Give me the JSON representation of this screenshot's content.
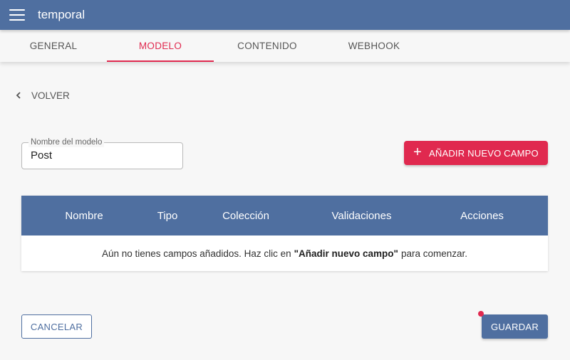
{
  "appbar": {
    "menu_icon": "hamburger-menu-icon",
    "title": "temporal"
  },
  "tabs": [
    {
      "label": "GENERAL",
      "active": false
    },
    {
      "label": "MODELO",
      "active": true
    },
    {
      "label": "CONTENIDO",
      "active": false
    },
    {
      "label": "WEBHOOK",
      "active": false
    }
  ],
  "back": {
    "icon": "chevron-left-icon",
    "label": "VOLVER"
  },
  "model_name": {
    "label": "Nombre del modelo",
    "value": "Post"
  },
  "add_field": {
    "icon": "plus-icon",
    "label": "AÑADIR NUEVO CAMPO"
  },
  "table": {
    "columns": [
      "Nombre",
      "Tipo",
      "Colección",
      "Validaciones",
      "Acciones"
    ],
    "empty_prefix": "Aún no tienes campos añadidos. Haz clic en",
    "empty_highlight": "\"Añadir nuevo campo\"",
    "empty_suffix": "para comenzar."
  },
  "actions": {
    "cancel_label": "CANCELAR",
    "save_label": "GUARDAR"
  },
  "colors": {
    "primary": "#4f6fa0",
    "accent": "#e0294f",
    "background": "#f7f7f7"
  }
}
